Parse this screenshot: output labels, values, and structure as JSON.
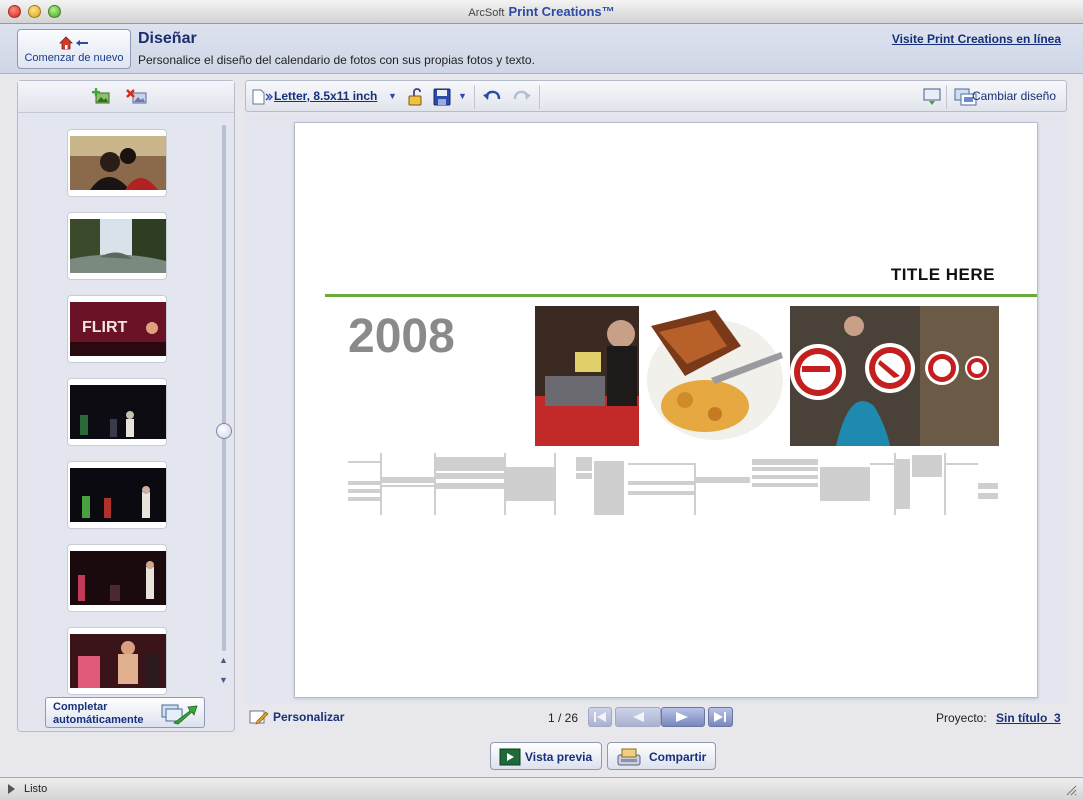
{
  "window": {
    "brand_prefix": "ArcSoft",
    "brand_name": "Print Creations™"
  },
  "header": {
    "start_over_label": "Comenzar de nuevo",
    "title": "Diseñar",
    "subtitle": "Personalice el diseño del calendario de fotos con sus propias fotos y texto.",
    "visit_link": "Visite Print Creations en línea"
  },
  "left_panel": {
    "add_photo_icon": "add-photo-icon",
    "remove_photo_icon": "remove-photo-icon",
    "thumbnails": [
      {
        "name": "couple-indoor"
      },
      {
        "name": "river-path"
      },
      {
        "name": "flirt-banner"
      },
      {
        "name": "dark-party-1"
      },
      {
        "name": "dark-party-2"
      },
      {
        "name": "dark-party-3"
      },
      {
        "name": "shirtless-dance"
      }
    ],
    "auto_complete_label_1": "Completar",
    "auto_complete_label_2": "automáticamente"
  },
  "toolbar": {
    "paper_size": "Letter, 8.5x11 inch",
    "change_design": "Cambiar diseño"
  },
  "calendar": {
    "title": "TITLE HERE",
    "year": "2008"
  },
  "footer": {
    "personalize": "Personalizar",
    "page_indicator": "1 / 26",
    "project_label": "Proyecto:",
    "project_name": "Sin título_3",
    "preview": "Vista previa",
    "share": "Compartir"
  },
  "status": {
    "text": "Listo"
  },
  "colors": {
    "accent": "#17307a",
    "green_rule": "#6aaa3a"
  }
}
